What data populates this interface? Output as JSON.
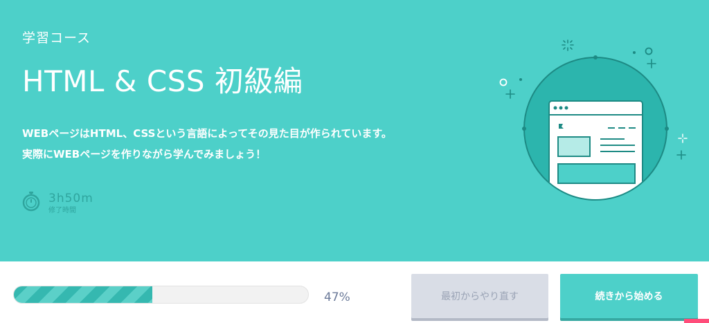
{
  "hero": {
    "course_type": "学習コース",
    "title": "HTML & CSS 初級編",
    "description_line1": "WEBページはHTML、CSSという言語によってその見た目が作られています。",
    "description_line2": "実際にWEBページを作りながら学んでみましょう！",
    "duration": "3h50m",
    "duration_label": "修了時間",
    "icon": "stopwatch-icon",
    "illustration": "webpage-illustration"
  },
  "progress": {
    "value": 0.47,
    "label": "47%"
  },
  "buttons": {
    "restart_label": "最初からやり直す",
    "continue_label": "続きから始める"
  },
  "colors": {
    "accent": "#4dd0c9",
    "accent_dark": "#35b8b0",
    "button_disabled": "#d9dde6"
  }
}
